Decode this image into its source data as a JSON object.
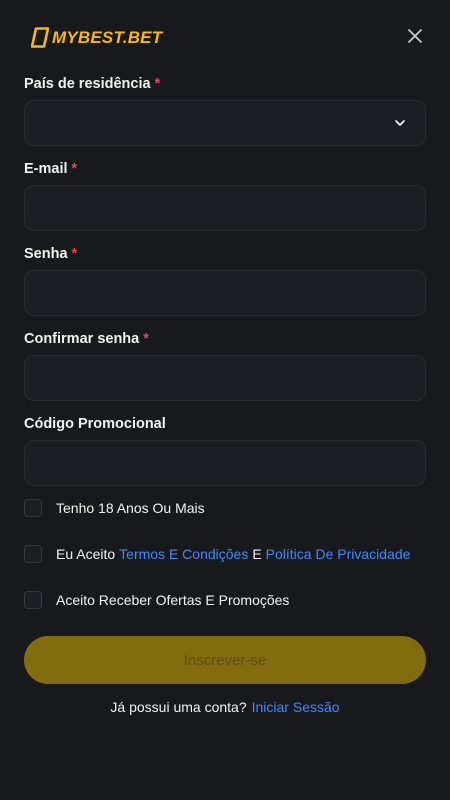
{
  "header": {
    "logo_text": "MYBEST.BET",
    "brand_color": "#f6b81a",
    "close_icon": "close-icon"
  },
  "form": {
    "country": {
      "label": "País de residência",
      "required_mark": "*",
      "value": ""
    },
    "email": {
      "label": "E-mail",
      "required_mark": "*",
      "value": ""
    },
    "password": {
      "label": "Senha",
      "required_mark": "*",
      "value": ""
    },
    "confirm_password": {
      "label": "Confirmar senha",
      "required_mark": "*",
      "value": ""
    },
    "promo_code": {
      "label": "Código Promocional",
      "value": ""
    }
  },
  "checkboxes": {
    "age": {
      "label": "Tenho 18 Anos Ou Mais",
      "checked": false
    },
    "terms": {
      "prefix": "Eu Aceito",
      "terms_link": "Termos E Condições",
      "conjunction": "E",
      "privacy_link": "Política De Privacidade",
      "checked": false
    },
    "offers": {
      "label": "Aceito Receber Ofertas E Promoções",
      "checked": false
    }
  },
  "submit": {
    "label": "Inscrever-se",
    "color": "#836b0f"
  },
  "footer": {
    "text": "Já possui uma conta?",
    "login_link": "Iniciar Sessão",
    "link_color": "#3d8bff"
  }
}
